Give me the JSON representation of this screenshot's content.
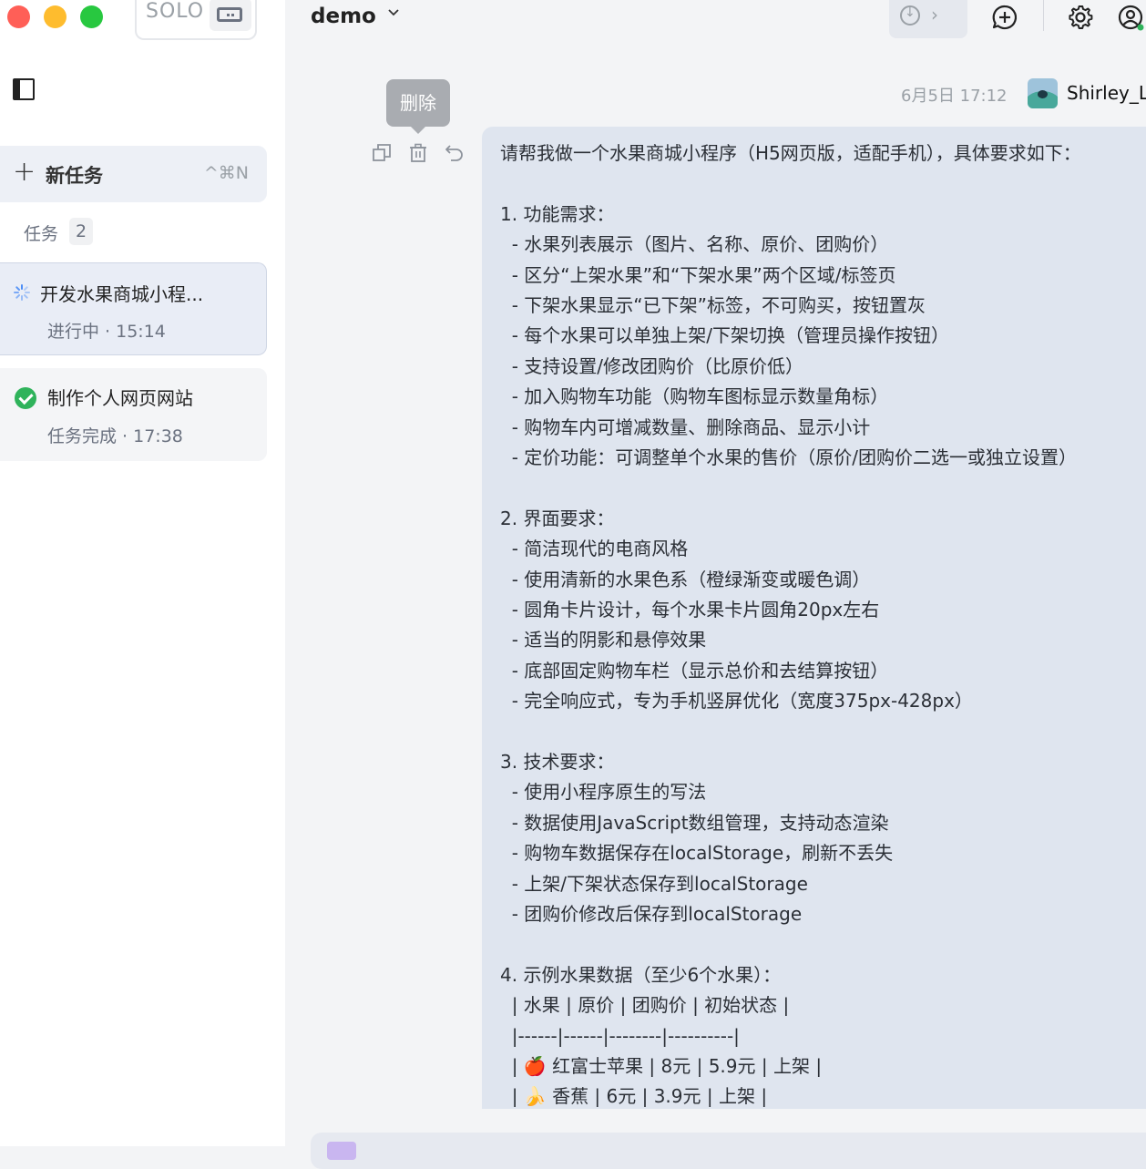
{
  "window": {
    "brand_label": "SOLO",
    "project_name": "demo"
  },
  "sidebar": {
    "new_task_label": "新任务",
    "new_task_shortcut": "^⌘N",
    "tasks_header": "任务",
    "tasks_count": "2",
    "tasks": [
      {
        "title": "开发水果商城小程...",
        "status": "进行中 · 15:14",
        "state": "in-progress"
      },
      {
        "title": "制作个人网页网站",
        "status": "任务完成 · 17:38",
        "state": "completed"
      }
    ]
  },
  "message": {
    "timestamp": "6月5日 17:12",
    "user": "Shirley_L",
    "tooltip": "删除",
    "lines": [
      "请帮我做一个水果商城小程序（H5网页版，适配手机），具体要求如下：",
      "",
      "1. 功能需求：",
      "  - 水果列表展示（图片、名称、原价、团购价）",
      "  - 区分“上架水果”和“下架水果”两个区域/标签页",
      "  - 下架水果显示“已下架”标签，不可购买，按钮置灰",
      "  - 每个水果可以单独上架/下架切换（管理员操作按钮）",
      "  - 支持设置/修改团购价（比原价低）",
      "  - 加入购物车功能（购物车图标显示数量角标）",
      "  - 购物车内可增减数量、删除商品、显示小计",
      "  - 定价功能：可调整单个水果的售价（原价/团购价二选一或独立设置）",
      "",
      "2. 界面要求：",
      "  - 简洁现代的电商风格",
      "  - 使用清新的水果色系（橙绿渐变或暖色调）",
      "  - 圆角卡片设计，每个水果卡片圆角20px左右",
      "  - 适当的阴影和悬停效果",
      "  - 底部固定购物车栏（显示总价和去结算按钮）",
      "  - 完全响应式，专为手机竖屏优化（宽度375px-428px）",
      "",
      "3. 技术要求：",
      "  - 使用小程序原生的写法",
      "  - 数据使用JavaScript数组管理，支持动态渲染",
      "  - 购物车数据保存在localStorage，刷新不丢失",
      "  - 上架/下架状态保存到localStorage",
      "  - 团购价修改后保存到localStorage",
      "",
      "4. 示例水果数据（至少6个水果）：",
      "  | 水果 | 原价 | 团购价 | 初始状态 |",
      "  |------|------|--------|----------|",
      "  | 🍎 红富士苹果 | 8元 | 5.9元 | 上架 |",
      "  | 🍌 香蕉 | 6元 | 3.9元 | 上架 |"
    ]
  },
  "icons": {
    "new_chat": "new-chat-icon",
    "settings": "gear-icon",
    "account": "user-circle-icon",
    "copy": "copy-icon",
    "delete": "trash-icon",
    "undo": "undo-icon"
  },
  "colors": {
    "bubble_bg": "#dfe5ef",
    "active_task_bg": "#e9edf6",
    "success": "#2fb35b",
    "spinner": "#4c8df6"
  }
}
